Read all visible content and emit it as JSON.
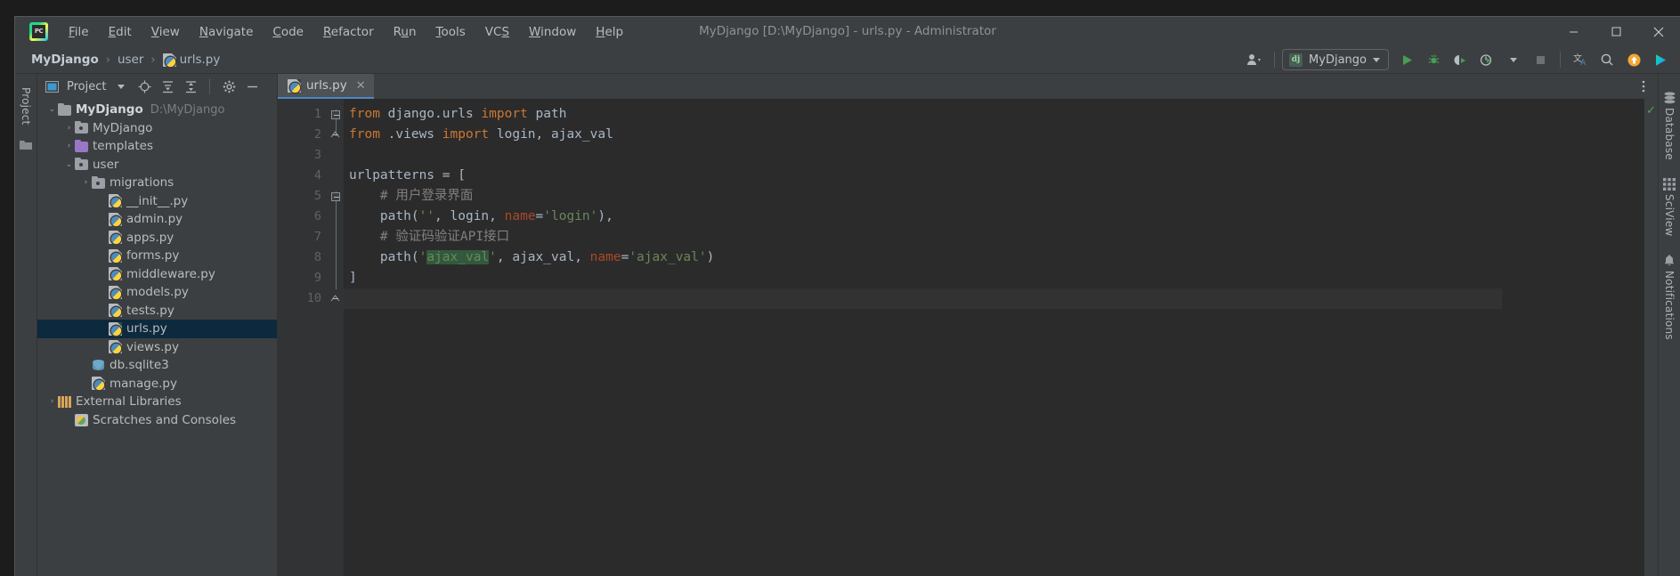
{
  "window": {
    "title": "MyDjango [D:\\MyDjango] - urls.py - Administrator",
    "minimize_label": "─",
    "maximize_label": "☐",
    "close_label": "✕"
  },
  "menubar": {
    "logo": "pycharm-logo",
    "items": [
      {
        "label": "File"
      },
      {
        "label": "Edit"
      },
      {
        "label": "View"
      },
      {
        "label": "Navigate"
      },
      {
        "label": "Code"
      },
      {
        "label": "Refactor"
      },
      {
        "label": "Run"
      },
      {
        "label": "Tools"
      },
      {
        "label": "VCS"
      },
      {
        "label": "Window"
      },
      {
        "label": "Help"
      }
    ]
  },
  "navbar": {
    "breadcrumbs": [
      {
        "label": "MyDjango",
        "icon": ""
      },
      {
        "label": "user",
        "icon": ""
      },
      {
        "label": "urls.py",
        "icon": "python-file-icon"
      }
    ],
    "separator": "›",
    "account_icon": "user-account-icon",
    "run_config": {
      "badge": "dj",
      "name": "MyDjango"
    },
    "buttons": [
      {
        "name": "run-button",
        "icon": "run-icon"
      },
      {
        "name": "debug-button",
        "icon": "debug-icon"
      },
      {
        "name": "run-coverage-button",
        "icon": "coverage-icon"
      },
      {
        "name": "profile-button",
        "icon": "profile-icon"
      },
      {
        "name": "stop-button",
        "icon": "stop-icon"
      },
      {
        "name": "translate-button",
        "icon": "translate-icon"
      },
      {
        "name": "search-everywhere-button",
        "icon": "search-icon"
      },
      {
        "name": "update-button",
        "icon": "update-arrow-icon"
      },
      {
        "name": "ide-feature-button",
        "icon": "play-badge-icon"
      }
    ]
  },
  "left_strip": {
    "label": "Project",
    "structure_icon": "folder-icon"
  },
  "project_panel": {
    "title": "Project",
    "toolbar": [
      {
        "name": "panel-dropdown",
        "icon": "chevron-down-icon"
      },
      {
        "name": "scroll-from-source-button",
        "icon": "target-icon"
      },
      {
        "name": "expand-all-button",
        "icon": "expand-all-icon"
      },
      {
        "name": "collapse-all-button",
        "icon": "collapse-all-icon"
      },
      {
        "name": "settings-button",
        "icon": "gear-icon"
      },
      {
        "name": "hide-panel-button",
        "icon": "minus-icon"
      }
    ],
    "tree": [
      {
        "label": "MyDjango",
        "note": "D:\\MyDjango",
        "indent": 0,
        "arrow": "⌄",
        "icon": "folder",
        "bold": true,
        "selected": false
      },
      {
        "label": "MyDjango",
        "note": "",
        "indent": 1,
        "arrow": "›",
        "icon": "folder-src",
        "bold": false,
        "selected": false
      },
      {
        "label": "templates",
        "note": "",
        "indent": 1,
        "arrow": "›",
        "icon": "folder-template",
        "bold": false,
        "selected": false
      },
      {
        "label": "user",
        "note": "",
        "indent": 1,
        "arrow": "⌄",
        "icon": "folder-src",
        "bold": false,
        "selected": false
      },
      {
        "label": "migrations",
        "note": "",
        "indent": 2,
        "arrow": "›",
        "icon": "folder-src",
        "bold": false,
        "selected": false
      },
      {
        "label": "__init__.py",
        "note": "",
        "indent": 3,
        "arrow": "",
        "icon": "python",
        "bold": false,
        "selected": false
      },
      {
        "label": "admin.py",
        "note": "",
        "indent": 3,
        "arrow": "",
        "icon": "python",
        "bold": false,
        "selected": false
      },
      {
        "label": "apps.py",
        "note": "",
        "indent": 3,
        "arrow": "",
        "icon": "python",
        "bold": false,
        "selected": false
      },
      {
        "label": "forms.py",
        "note": "",
        "indent": 3,
        "arrow": "",
        "icon": "python",
        "bold": false,
        "selected": false
      },
      {
        "label": "middleware.py",
        "note": "",
        "indent": 3,
        "arrow": "",
        "icon": "python",
        "bold": false,
        "selected": false
      },
      {
        "label": "models.py",
        "note": "",
        "indent": 3,
        "arrow": "",
        "icon": "python",
        "bold": false,
        "selected": false
      },
      {
        "label": "tests.py",
        "note": "",
        "indent": 3,
        "arrow": "",
        "icon": "python",
        "bold": false,
        "selected": false
      },
      {
        "label": "urls.py",
        "note": "",
        "indent": 3,
        "arrow": "",
        "icon": "python",
        "bold": false,
        "selected": true
      },
      {
        "label": "views.py",
        "note": "",
        "indent": 3,
        "arrow": "",
        "icon": "python",
        "bold": false,
        "selected": false
      },
      {
        "label": "db.sqlite3",
        "note": "",
        "indent": 2,
        "arrow": "",
        "icon": "database",
        "bold": false,
        "selected": false
      },
      {
        "label": "manage.py",
        "note": "",
        "indent": 2,
        "arrow": "",
        "icon": "python",
        "bold": false,
        "selected": false
      },
      {
        "label": "External Libraries",
        "note": "",
        "indent": 0,
        "arrow": "›",
        "icon": "library",
        "bold": false,
        "selected": false
      },
      {
        "label": "Scratches and Consoles",
        "note": "",
        "indent": 1,
        "arrow": "",
        "icon": "scratch",
        "bold": false,
        "selected": false
      }
    ]
  },
  "editor": {
    "tab": {
      "label": "urls.py",
      "icon": "python-file-icon",
      "close": "✕"
    },
    "options_icon": "more-options-icon",
    "inspection_status": "✓",
    "line_numbers": [
      "1",
      "2",
      "3",
      "4",
      "5",
      "6",
      "7",
      "8",
      "9",
      "10"
    ],
    "caret_line": 10,
    "lines": [
      {
        "n": 1,
        "tokens": [
          {
            "t": "from ",
            "c": "kw"
          },
          {
            "t": "django.urls ",
            "c": "id"
          },
          {
            "t": "import ",
            "c": "kw"
          },
          {
            "t": "path",
            "c": "id"
          }
        ]
      },
      {
        "n": 2,
        "tokens": [
          {
            "t": "from ",
            "c": "kw"
          },
          {
            "t": ".views ",
            "c": "id"
          },
          {
            "t": "import ",
            "c": "kw"
          },
          {
            "t": "login, ajax_val",
            "c": "id"
          }
        ]
      },
      {
        "n": 3,
        "tokens": []
      },
      {
        "n": 4,
        "tokens": [
          {
            "t": "urlpatterns = [",
            "c": "id"
          }
        ]
      },
      {
        "n": 5,
        "tokens": [
          {
            "t": "    # 用户登录界面",
            "c": "cmt"
          }
        ]
      },
      {
        "n": 6,
        "tokens": [
          {
            "t": "    path(",
            "c": "id"
          },
          {
            "t": "''",
            "c": "str"
          },
          {
            "t": ", login, ",
            "c": "id"
          },
          {
            "t": "name",
            "c": "kwarg"
          },
          {
            "t": "=",
            "c": "id"
          },
          {
            "t": "'login'",
            "c": "str"
          },
          {
            "t": "),",
            "c": "id"
          }
        ]
      },
      {
        "n": 7,
        "tokens": [
          {
            "t": "    # 验证码验证API接口",
            "c": "cmt"
          }
        ]
      },
      {
        "n": 8,
        "tokens": [
          {
            "t": "    path(",
            "c": "id"
          },
          {
            "t": "'",
            "c": "str"
          },
          {
            "t": "ajax_val",
            "c": "str hl"
          },
          {
            "t": "'",
            "c": "str"
          },
          {
            "t": ", ajax_val, ",
            "c": "id"
          },
          {
            "t": "name",
            "c": "kwarg"
          },
          {
            "t": "=",
            "c": "id"
          },
          {
            "t": "'ajax_val'",
            "c": "str"
          },
          {
            "t": ")",
            "c": "id"
          }
        ]
      },
      {
        "n": 9,
        "tokens": [
          {
            "t": "]",
            "c": "id"
          }
        ]
      },
      {
        "n": 10,
        "tokens": []
      }
    ]
  },
  "right_strip": {
    "items": [
      {
        "label": "Database",
        "icon": "database-icon"
      },
      {
        "label": "SciView",
        "icon": "grid-icon"
      },
      {
        "label": "Notifications",
        "icon": "bell-icon"
      }
    ]
  },
  "colors": {
    "chrome": "#3c3f41",
    "editor_bg": "#2b2b2b",
    "gutter_bg": "#313335",
    "selection": "#0d293e",
    "keyword": "#cc7832",
    "string": "#6a8759",
    "comment": "#808080",
    "identifier": "#a9b7c6",
    "kwarg": "#aa4926",
    "highlight": "#32593d",
    "tab_underline": "#4a88c7",
    "run_green": "#499c54"
  }
}
